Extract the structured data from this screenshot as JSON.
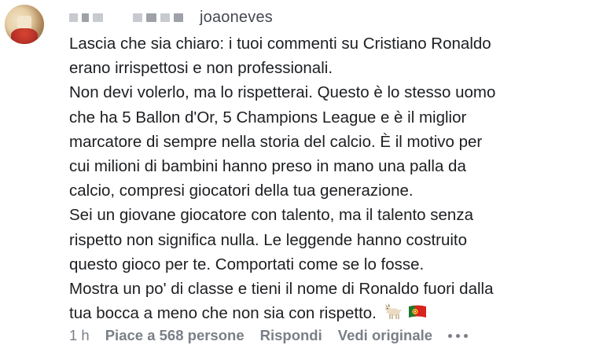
{
  "comment": {
    "username": "joaoneves",
    "text_lines": [
      "Lascia che sia chiaro: i tuoi commenti su Cristiano Ronaldo",
      "erano irrispettosi e non professionali.",
      "Non devi volerlo, ma lo rispetterai. Questo è lo stesso uomo",
      "che ha 5 Ballon d'Or, 5 Champions League e è il miglior",
      "marcatore di sempre nella storia del calcio. È il motivo per",
      "cui milioni di bambini hanno preso in mano una palla da",
      "calcio, compresi giocatori della tua generazione.",
      "Sei un giovane giocatore con talento, ma il talento senza",
      "rispetto non significa nulla. Le leggende hanno costruito",
      "questo gioco per te. Comportati come se lo fosse.",
      "Mostra un po' di classe e tieni il nome di Ronaldo fuori dalla",
      "tua bocca a meno che non sia con rispetto."
    ],
    "emojis": [
      "goat-emoji",
      "portugal-flag-emoji"
    ]
  },
  "actions": {
    "time": "1 h",
    "likes": "Piace a 568 persone",
    "reply": "Rispondi",
    "see_original": "Vedi originale"
  },
  "icons": {
    "more": "more-options-icon"
  },
  "colors": {
    "text": "#1c1e21",
    "meta": "#7a7f87",
    "username": "#444950"
  }
}
